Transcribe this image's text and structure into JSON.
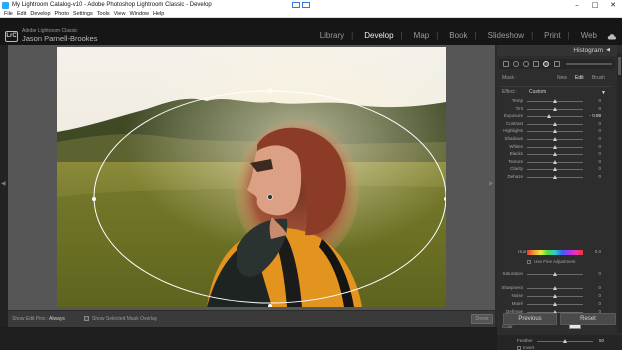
{
  "window": {
    "title": "My Lightroom Catalog-v10 - Adobe Photoshop Lightroom Classic - Develop",
    "min_glyph": "–",
    "max_glyph": "□",
    "close_glyph": "✕"
  },
  "menu": [
    "File",
    "Edit",
    "Develop",
    "Photo",
    "Settings",
    "Tools",
    "View",
    "Window",
    "Help"
  ],
  "identity": {
    "logo_text": "LrC",
    "app_name": "Adobe Lightroom Classic",
    "user_name": "Jason Parnell-Brookes"
  },
  "modules": [
    {
      "label": "Library",
      "active": false
    },
    {
      "label": "Develop",
      "active": true
    },
    {
      "label": "Map",
      "active": false
    },
    {
      "label": "Book",
      "active": false
    },
    {
      "label": "Slideshow",
      "active": false
    },
    {
      "label": "Print",
      "active": false
    },
    {
      "label": "Web",
      "active": false
    }
  ],
  "toolbar": {
    "show_edit_pins_label": "Show Edit Pins :",
    "show_edit_pins_value": "Always",
    "show_mask_overlay_label": "Show Selected Mask Overlay",
    "done_label": "Done"
  },
  "panel": {
    "histogram_title": "Histogram",
    "mask_label": "Mask :",
    "mask_modes": [
      "New",
      "Edit",
      "Brush"
    ],
    "active_mask_mode": "Edit",
    "effect_label": "Effect :",
    "effect_value": "Custom",
    "sliders": [
      {
        "label": "Temp",
        "value": "0",
        "pos": 0.5
      },
      {
        "label": "Tint",
        "value": "0",
        "pos": 0.5
      },
      {
        "label": "Exposure",
        "value": "- 0.89",
        "pos": 0.4,
        "highlight": true
      },
      {
        "label": "Contrast",
        "value": "0",
        "pos": 0.5
      },
      {
        "label": "Highlights",
        "value": "0",
        "pos": 0.5
      },
      {
        "label": "Shadows",
        "value": "0",
        "pos": 0.5
      },
      {
        "label": "Whites",
        "value": "0",
        "pos": 0.5
      },
      {
        "label": "Blacks",
        "value": "0",
        "pos": 0.5
      },
      {
        "label": "Texture",
        "value": "0",
        "pos": 0.5
      },
      {
        "label": "Clarity",
        "value": "0",
        "pos": 0.5
      },
      {
        "label": "Dehaze",
        "value": "0",
        "pos": 0.5
      }
    ],
    "hue": {
      "label": "Hue",
      "value": "0.0"
    },
    "fine_adjust_label": "Use Fine Adjustment",
    "sliders2": [
      {
        "label": "Saturation",
        "value": "0",
        "pos": 0.5
      }
    ],
    "sliders3": [
      {
        "label": "Sharpness",
        "value": "0",
        "pos": 0.5
      },
      {
        "label": "Noise",
        "value": "0",
        "pos": 0.5
      },
      {
        "label": "Moiré",
        "value": "0",
        "pos": 0.5
      },
      {
        "label": "Defringe",
        "value": "0",
        "pos": 0.5
      }
    ],
    "color_label": "Color",
    "feather_label": "Feather",
    "feather_value": "50",
    "feather_pos": 0.5,
    "invert_label": "Invert",
    "previous_label": "Previous",
    "reset_label": "Reset"
  }
}
